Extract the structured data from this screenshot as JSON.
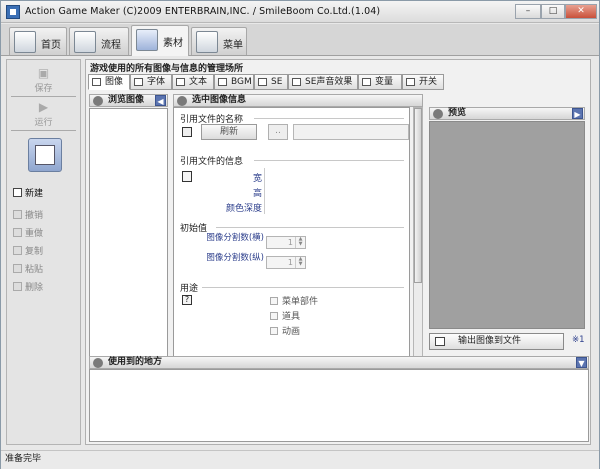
{
  "window": {
    "title": "Action Game Maker (C)2009 ENTERBRAIN,INC. / SmileBoom Co.Ltd.(1.04)"
  },
  "main_tabs": [
    {
      "label": "首页",
      "icon": "home-icon"
    },
    {
      "label": "流程",
      "icon": "flow-icon"
    },
    {
      "label": "素材",
      "icon": "material-icon",
      "active": true
    },
    {
      "label": "菜单",
      "icon": "menu-icon"
    }
  ],
  "left_toolbar": {
    "save": "保存",
    "run": "运行",
    "items": [
      "新建",
      "撤销",
      "重做",
      "复制",
      "粘贴",
      "删除"
    ]
  },
  "content": {
    "title": "游戏使用的所有图像与信息的管理场所",
    "sub_tabs": [
      "图像",
      "字体",
      "文本",
      "BGM",
      "SE",
      "SE声音效果",
      "变量",
      "开关"
    ],
    "browse_header": "浏览图像",
    "info_header": "选中图像信息",
    "preview_header": "预览",
    "used_header": "使用到的地方",
    "ref_file_name": {
      "label": "引用文件的名称",
      "refresh": "刷新",
      "dots": "..",
      "value": ""
    },
    "ref_file_info": {
      "label": "引用文件的信息",
      "width": "宽",
      "height": "高",
      "color_depth": "颜色深度"
    },
    "initial": {
      "label": "初始值",
      "h_split": "图像分割数(横)",
      "v_split": "图像分割数(纵)",
      "h_value": "1",
      "v_value": "1"
    },
    "usage": {
      "label": "用途",
      "options": [
        "菜单部件",
        "道具",
        "动画"
      ]
    },
    "export_button": "输出图像到文件",
    "note": "※1"
  },
  "status": "准备完毕",
  "colors": {
    "accent": "#5b74b0",
    "preview_bg": "#a0a0a0",
    "label_blue": "#2d3f8c"
  }
}
